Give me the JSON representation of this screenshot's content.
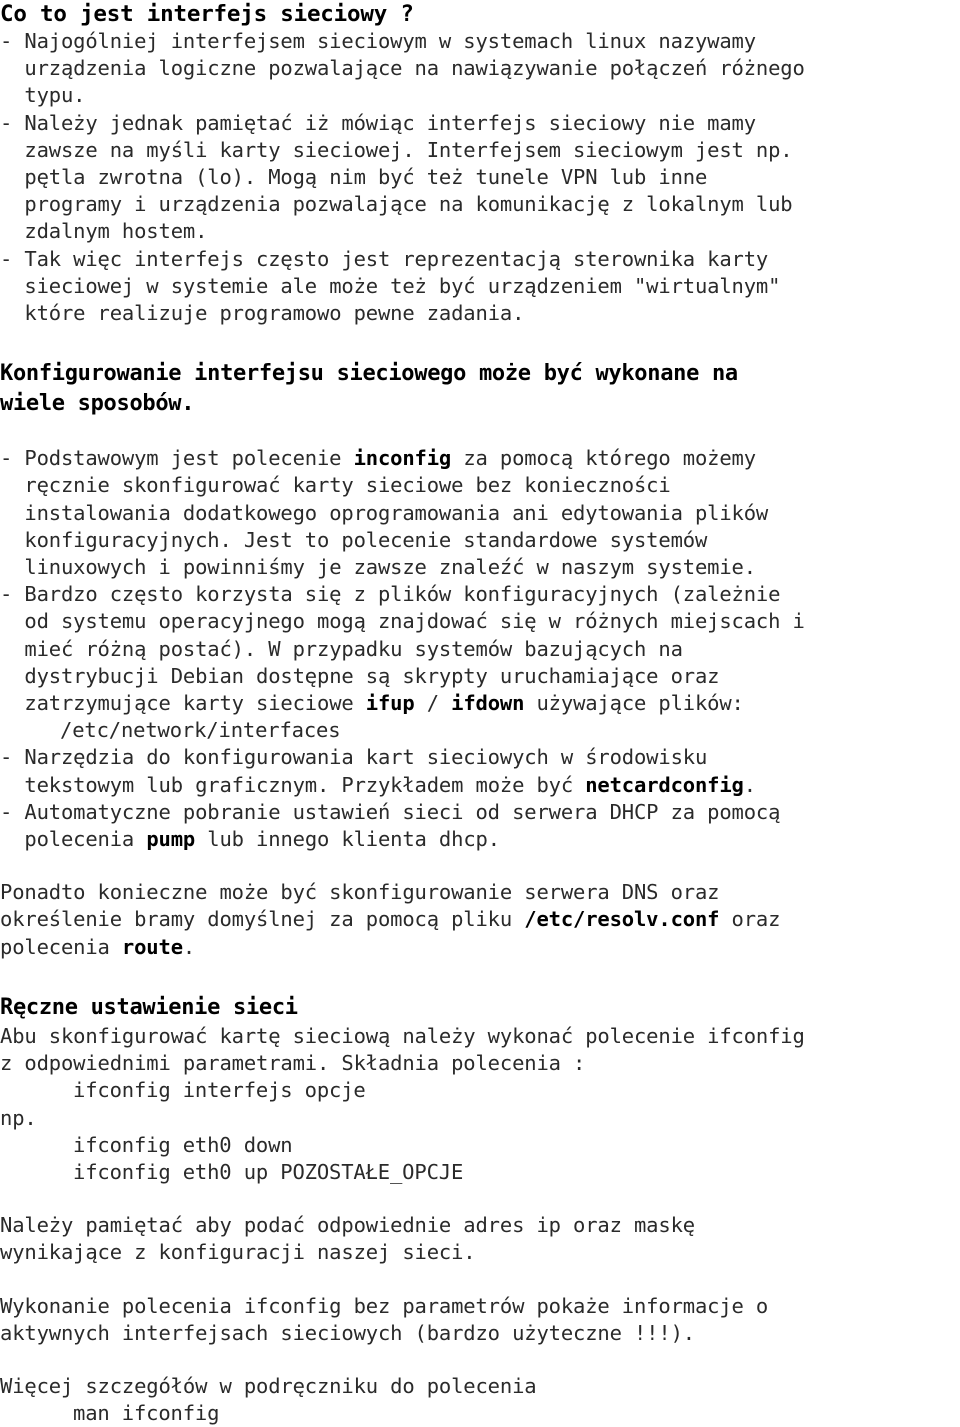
{
  "document": {
    "title": "Co to jest interfejs sieciowy ?",
    "language": "pl",
    "section1": {
      "heading": "Co to jest interfejs sieciowy ?",
      "bullets": [
        "- Najogólniej interfejsem sieciowym w systemach linux nazywamy\n  urządzenia logiczne pozwalające na nawiązywanie połączeń różnego\n  typu.",
        "- Należy jednak pamiętać iż mówiąc interfejs sieciowy nie mamy\n  zawsze na myśli karty sieciowej. Interfejsem sieciowym jest np.\n  pętla zwrotna (lo). Mogą nim być też tunele VPN lub inne\n  programy i urządzenia pozwalające na komunikację z lokalnym lub\n  zdalnym hostem.",
        "- Tak więc interfejs często jest reprezentacją sterownika karty\n  sieciowej w systemie ale może też być urządzeniem \"wirtualnym\"\n  które realizuje programowo pewne zadania."
      ]
    },
    "section2": {
      "heading": "Konfigurowanie interfejsu sieciowego może być wykonane na\nwiele sposobów.",
      "bullet1": {
        "pre": "- Podstawowym jest polecenie ",
        "code": "inconfig",
        "post": " za pomocą którego możemy\n  ręcznie skonfigurować karty sieciowe bez konieczności\n  instalowania dodatkowego oprogramowania ani edytowania plików\n  konfiguracyjnych. Jest to polecenie standardowe systemów\n  linuxowych i powinniśmy je zawsze znaleźć w naszym systemie."
      },
      "bullet2": {
        "pre": "- Bardzo często korzysta się z plików konfiguracyjnych (zależnie\n  od systemu operacyjnego mogą znajdować się w różnych miejscach i\n  mieć różną postać). W przypadku systemów bazujących na\n  dystrybucji Debian dostępne są skrypty uruchamiające oraz\n  zatrzymujące karty sieciowe ",
        "code1": "ifup",
        "mid": " / ",
        "code2": "ifdown",
        "post": " używające plików:"
      },
      "path_line": "/etc/network/interfaces",
      "bullet3": {
        "pre": "- Narzędzia do konfigurowania kart sieciowych w środowisku\n  tekstowym lub graficznym. Przykładem może być ",
        "code": "netcardconfig",
        "post": "."
      },
      "bullet4": {
        "pre": "- Automatyczne pobranie ustawień sieci od serwera DHCP za pomocą\n  polecenia ",
        "code": "pump",
        "post": " lub innego klienta dhcp."
      },
      "paragraph": {
        "pre": "Ponadto konieczne może być skonfigurowanie serwera DNS oraz\nokreślenie bramy domyślnej za pomocą pliku ",
        "code1": "/etc/resolv.conf",
        "mid": " oraz\npolecenia ",
        "code2": "route",
        "post": "."
      }
    },
    "section3": {
      "heading": "Ręczne ustawienie sieci",
      "intro": "Abu skonfigurować kartę sieciową należy wykonać polecenie ifconfig\nz odpowiednimi parametrami. Składnia polecenia :",
      "syntax": "ifconfig interfejs opcje",
      "np_label": "np.",
      "examples": "ifconfig eth0 down\nifconfig eth0 up POZOSTAŁE_OPCJE",
      "note1": "Należy pamiętać aby podać odpowiednie adres ip oraz maskę\nwynikające z konfiguracji naszej sieci.",
      "note2": "Wykonanie polecenia ifconfig bez parametrów pokaże informacje o\naktywnych interfejsach sieciowych (bardzo użyteczne !!!).",
      "note3": "Więcej szczegółów w podręczniku do polecenia",
      "man_cmd": "man ifconfig"
    }
  }
}
